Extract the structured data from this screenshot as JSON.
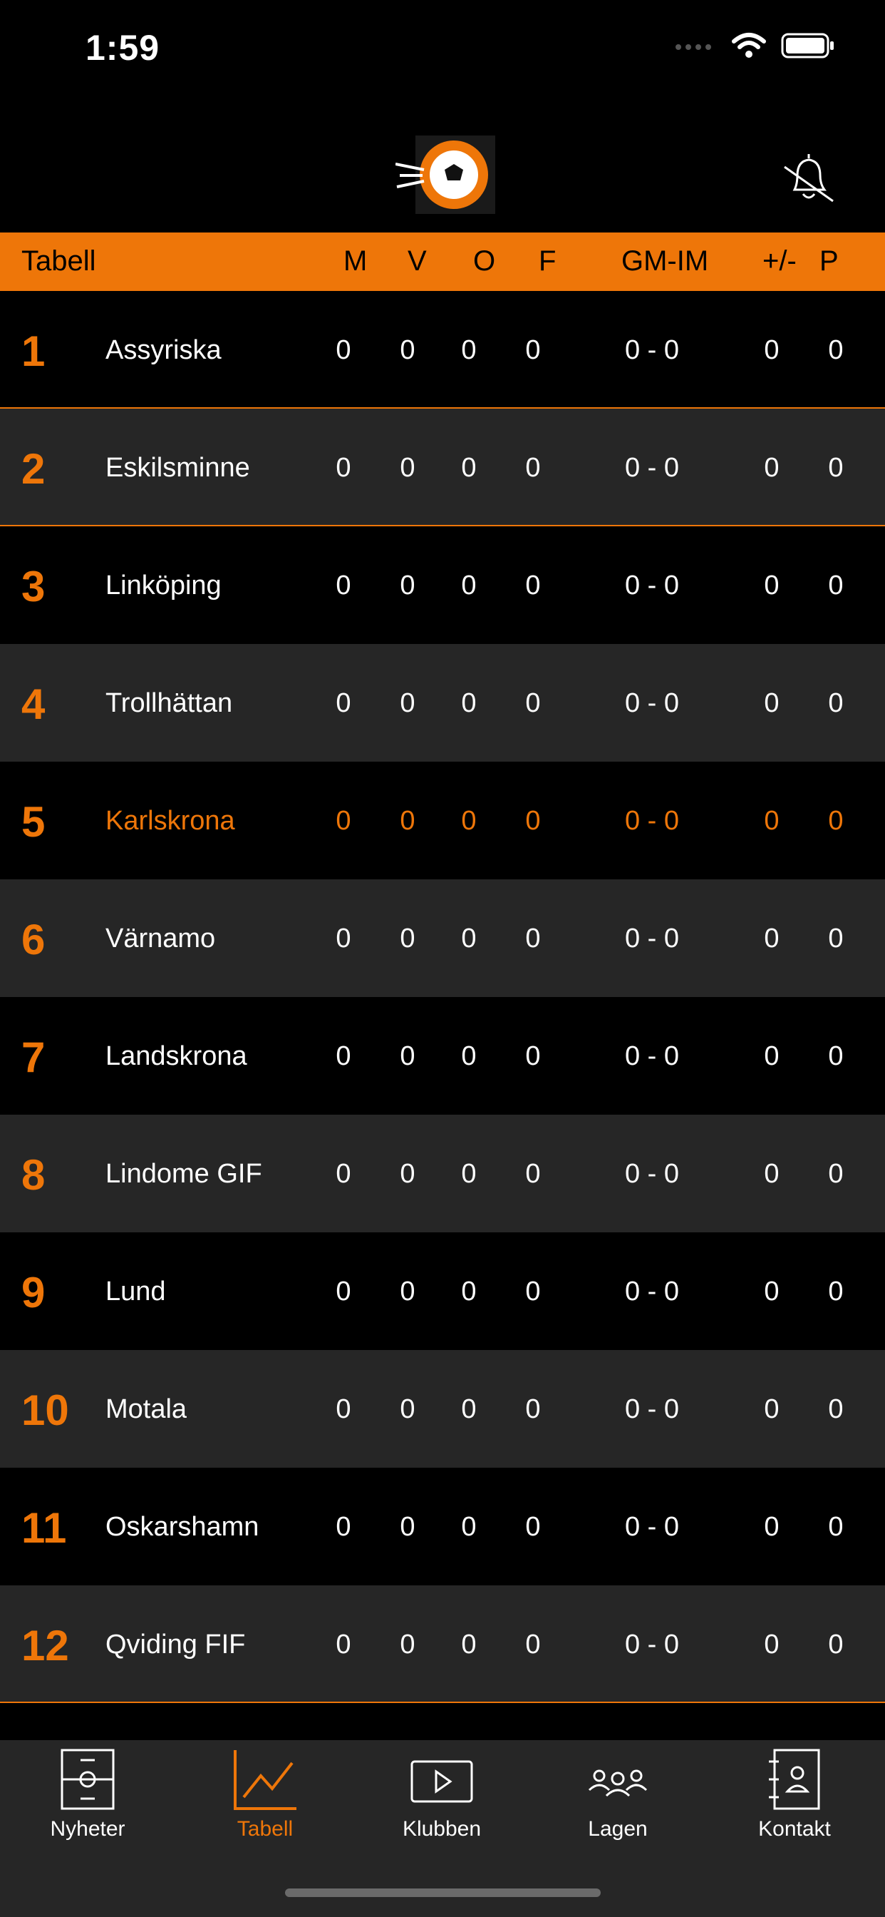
{
  "status_bar": {
    "time": "1:59"
  },
  "colors": {
    "accent": "#EE7609",
    "row_alt": "#262626",
    "background": "#000000"
  },
  "header": {
    "logo_icon": "club-logo",
    "bell_icon": "bell-off-icon"
  },
  "table": {
    "title": "Tabell",
    "columns": {
      "m": "M",
      "v": "V",
      "o": "O",
      "f": "F",
      "gmim": "GM-IM",
      "diff": "+/-",
      "p": "P"
    },
    "rows": [
      {
        "pos": "1",
        "team": "Assyriska",
        "m": "0",
        "v": "0",
        "o": "0",
        "f": "0",
        "gmim": "0 - 0",
        "diff": "0",
        "p": "0"
      },
      {
        "pos": "2",
        "team": "Eskilsminne",
        "m": "0",
        "v": "0",
        "o": "0",
        "f": "0",
        "gmim": "0 - 0",
        "diff": "0",
        "p": "0"
      },
      {
        "pos": "3",
        "team": "Linköping",
        "m": "0",
        "v": "0",
        "o": "0",
        "f": "0",
        "gmim": "0 - 0",
        "diff": "0",
        "p": "0"
      },
      {
        "pos": "4",
        "team": "Trollhättan",
        "m": "0",
        "v": "0",
        "o": "0",
        "f": "0",
        "gmim": "0 - 0",
        "diff": "0",
        "p": "0"
      },
      {
        "pos": "5",
        "team": "Karlskrona",
        "m": "0",
        "v": "0",
        "o": "0",
        "f": "0",
        "gmim": "0 - 0",
        "diff": "0",
        "p": "0"
      },
      {
        "pos": "6",
        "team": "Värnamo",
        "m": "0",
        "v": "0",
        "o": "0",
        "f": "0",
        "gmim": "0 - 0",
        "diff": "0",
        "p": "0"
      },
      {
        "pos": "7",
        "team": "Landskrona",
        "m": "0",
        "v": "0",
        "o": "0",
        "f": "0",
        "gmim": "0 - 0",
        "diff": "0",
        "p": "0"
      },
      {
        "pos": "8",
        "team": "Lindome GIF",
        "m": "0",
        "v": "0",
        "o": "0",
        "f": "0",
        "gmim": "0 - 0",
        "diff": "0",
        "p": "0"
      },
      {
        "pos": "9",
        "team": "Lund",
        "m": "0",
        "v": "0",
        "o": "0",
        "f": "0",
        "gmim": "0 - 0",
        "diff": "0",
        "p": "0"
      },
      {
        "pos": "10",
        "team": "Motala",
        "m": "0",
        "v": "0",
        "o": "0",
        "f": "0",
        "gmim": "0 - 0",
        "diff": "0",
        "p": "0"
      },
      {
        "pos": "11",
        "team": "Oskarshamn",
        "m": "0",
        "v": "0",
        "o": "0",
        "f": "0",
        "gmim": "0 - 0",
        "diff": "0",
        "p": "0"
      },
      {
        "pos": "12",
        "team": "Qviding FIF",
        "m": "0",
        "v": "0",
        "o": "0",
        "f": "0",
        "gmim": "0 - 0",
        "diff": "0",
        "p": "0"
      }
    ]
  },
  "tab_bar": {
    "items": [
      {
        "label": "Nyheter",
        "icon": "field-icon"
      },
      {
        "label": "Tabell",
        "icon": "chart-icon"
      },
      {
        "label": "Klubben",
        "icon": "play-icon"
      },
      {
        "label": "Lagen",
        "icon": "people-icon"
      },
      {
        "label": "Kontakt",
        "icon": "contact-book-icon"
      }
    ]
  }
}
